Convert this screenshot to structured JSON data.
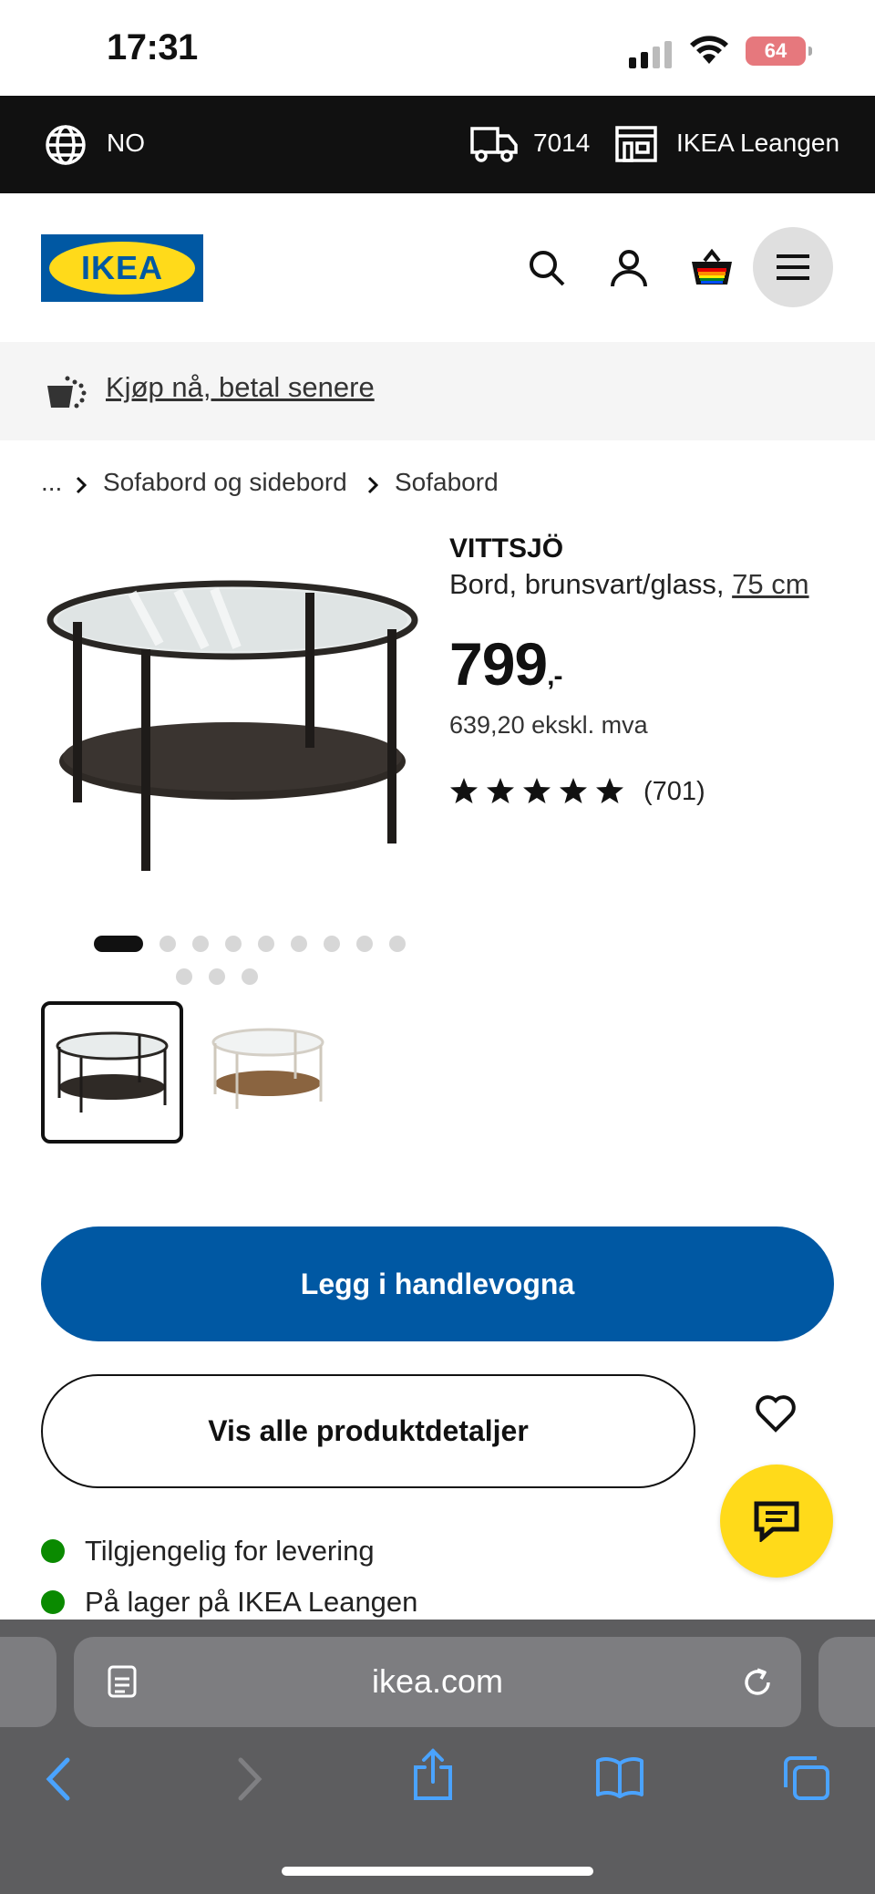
{
  "status_bar": {
    "time": "17:31",
    "battery": "64"
  },
  "topbar": {
    "country": "NO",
    "postcode": "7014",
    "store": "IKEA Leangen"
  },
  "promo": {
    "link": "Kjøp nå, betal senere"
  },
  "breadcrumb": {
    "ellipsis": "...",
    "items": [
      "Sofabord og sidebord",
      "Sofabord"
    ]
  },
  "product": {
    "name": "VITTSJÖ",
    "description": "Bord, brunsvart/glass, ",
    "size_link": "75 cm",
    "price": "799",
    "price_suffix": ",-",
    "ex_vat": "639,20 ekskl. mva",
    "rating": 5,
    "reviews": "(701)",
    "image_count": 12,
    "active_image": 1
  },
  "buttons": {
    "add_to_cart": "Legg i handlevogna",
    "details": "Vis alle produktdetaljer"
  },
  "availability": [
    "Tilgjengelig for levering",
    "På lager på IKEA Leangen"
  ],
  "browser": {
    "url": "ikea.com"
  },
  "colors": {
    "brand_blue": "#0058a3",
    "brand_yellow": "#ffda1a",
    "availability_green": "#0a8a00"
  }
}
